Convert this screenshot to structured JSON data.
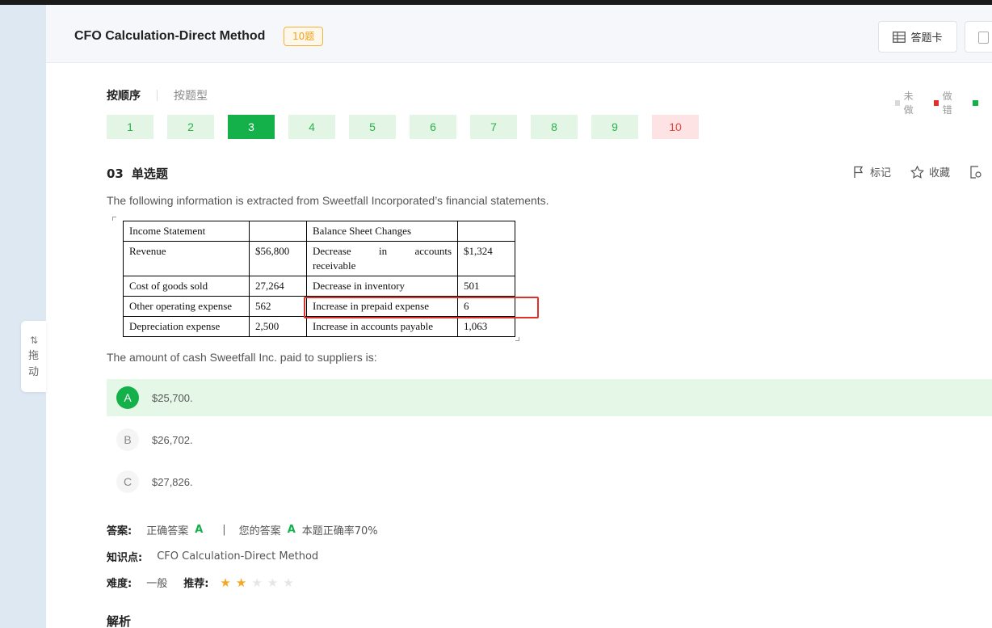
{
  "header": {
    "title": "CFO Calculation-Direct Method",
    "count_badge": "10题",
    "answer_card_label": "答题卡"
  },
  "sort_tabs": {
    "by_order": "按顺序",
    "by_type": "按题型"
  },
  "legend": {
    "items": [
      {
        "label": "未做",
        "color": "#d9d9d9"
      },
      {
        "label": "做错",
        "color": "#e0302a"
      },
      {
        "label": "",
        "color": "#14b14a"
      }
    ]
  },
  "question_nav": {
    "current": 3,
    "items": [
      {
        "label": "1",
        "status": "correct"
      },
      {
        "label": "2",
        "status": "correct"
      },
      {
        "label": "3",
        "status": "current"
      },
      {
        "label": "4",
        "status": "correct"
      },
      {
        "label": "5",
        "status": "correct"
      },
      {
        "label": "6",
        "status": "correct"
      },
      {
        "label": "7",
        "status": "correct"
      },
      {
        "label": "8",
        "status": "correct"
      },
      {
        "label": "9",
        "status": "correct"
      },
      {
        "label": "10",
        "status": "wrong"
      }
    ]
  },
  "question": {
    "number": "03",
    "type": "单选题",
    "tools": {
      "mark": "标记",
      "favorite": "收藏"
    },
    "stem": "The following information is extracted from Sweetfall Incorporated’s financial statements.",
    "table": {
      "rows": [
        [
          "Income Statement",
          "",
          "Balance Sheet Changes",
          ""
        ],
        [
          "Revenue",
          "$56,800",
          "Decrease in accounts receivable",
          "$1,324"
        ],
        [
          "Cost of goods sold",
          "27,264",
          "Decrease in inventory",
          "501"
        ],
        [
          "Other operating expense",
          "562",
          "Increase in prepaid expense",
          "6"
        ],
        [
          "Depreciation expense",
          "2,500",
          "Increase in accounts payable",
          "1,063"
        ]
      ],
      "wrapped_cell": {
        "words": [
          "Decrease",
          "in",
          "accounts"
        ],
        "second_line": "receivable"
      }
    },
    "ask": "The amount of cash Sweetfall Inc. paid to suppliers is:",
    "options": [
      {
        "letter": "A",
        "text": "$25,700.",
        "selected": true
      },
      {
        "letter": "B",
        "text": "$26,702.",
        "selected": false
      },
      {
        "letter": "C",
        "text": "$27,826.",
        "selected": false
      }
    ]
  },
  "answer": {
    "label": "答案:",
    "correct_label": "正确答案",
    "correct_value": "A",
    "separator": "|",
    "yours_label": "您的答案",
    "yours_value": "A",
    "accuracy": "本题正确率70%"
  },
  "knowledge": {
    "label": "知识点:",
    "value": "CFO Calculation-Direct Method"
  },
  "difficulty": {
    "label": "难度:",
    "value": "一般",
    "recommend_label": "推荐:",
    "stars": 2,
    "stars_max": 5
  },
  "drag_handle": {
    "line1": "拖",
    "line2": "动"
  },
  "analysis_title": "解析",
  "colors": {
    "accent_green": "#14b14a",
    "wrong_red": "#e0302a",
    "badge_orange": "#f2a31d"
  }
}
